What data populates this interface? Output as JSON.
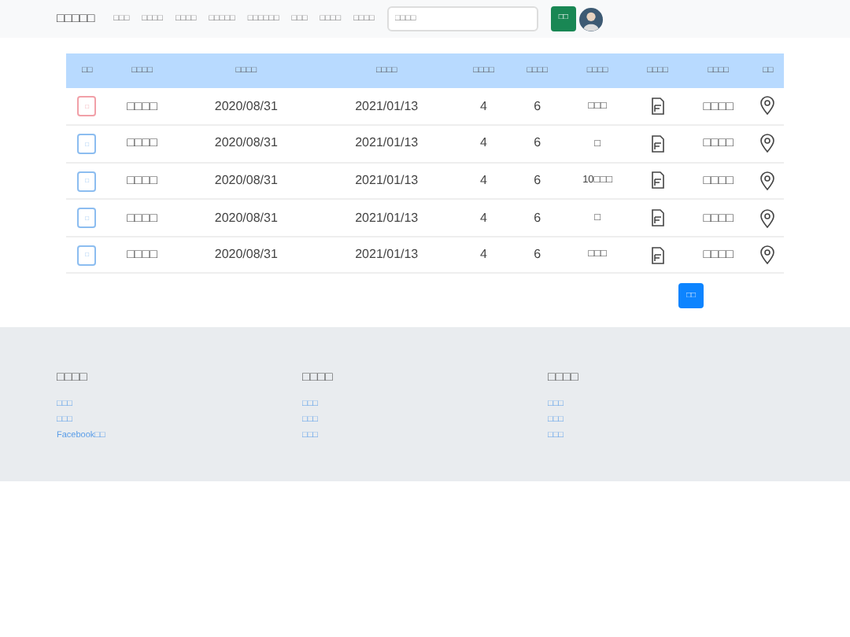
{
  "navbar": {
    "brand": "□□□□□",
    "links": [
      "□□□",
      "□□□□",
      "□□□□",
      "□□□□□",
      "□□□□□□",
      "□□□",
      "□□□□",
      "□□□□"
    ],
    "search": {
      "placeholder": "□□□□"
    },
    "search_button": "□□"
  },
  "table": {
    "columns": [
      "□□",
      "□□□□",
      "□□□□",
      "□□□□",
      "□□□□",
      "□□□□",
      "□□□□",
      "□□□□",
      "□□□□",
      "□□"
    ],
    "rows": [
      {
        "action": {
          "label": "□",
          "kind": "danger"
        },
        "column_2": "□□□□",
        "start": "2020/08/31",
        "end": "2021/01/13",
        "column_5": "4",
        "column_6": "6",
        "column_7": "□□□",
        "column_9": "□□□□"
      },
      {
        "action": {
          "label": "□",
          "kind": "primary"
        },
        "column_2": "□□□□",
        "start": "2020/08/31",
        "end": "2021/01/13",
        "column_5": "4",
        "column_6": "6",
        "column_7": "□",
        "column_9": "□□□□"
      },
      {
        "action": {
          "label": "□",
          "kind": "primary"
        },
        "column_2": "□□□□",
        "start": "2020/08/31",
        "end": "2021/01/13",
        "column_5": "4",
        "column_6": "6",
        "column_7": "10□□□",
        "column_9": "□□□□"
      },
      {
        "action": {
          "label": "□",
          "kind": "primary"
        },
        "column_2": "□□□□",
        "start": "2020/08/31",
        "end": "2021/01/13",
        "column_5": "4",
        "column_6": "6",
        "column_7": "□",
        "column_9": "□□□□"
      },
      {
        "action": {
          "label": "□",
          "kind": "primary"
        },
        "column_2": "□□□□",
        "start": "2020/08/31",
        "end": "2021/01/13",
        "column_5": "4",
        "column_6": "6",
        "column_7": "□□□",
        "column_9": "□□□□"
      }
    ]
  },
  "page_button": "□□",
  "footer": [
    {
      "heading": "□□□□",
      "links": [
        "□□□",
        "□□□",
        "Facebook□□"
      ]
    },
    {
      "heading": "□□□□",
      "links": [
        "□□□",
        "□□□",
        "□□□"
      ]
    },
    {
      "heading": "□□□□",
      "links": [
        "□□□",
        "□□□",
        "□□□"
      ]
    }
  ]
}
